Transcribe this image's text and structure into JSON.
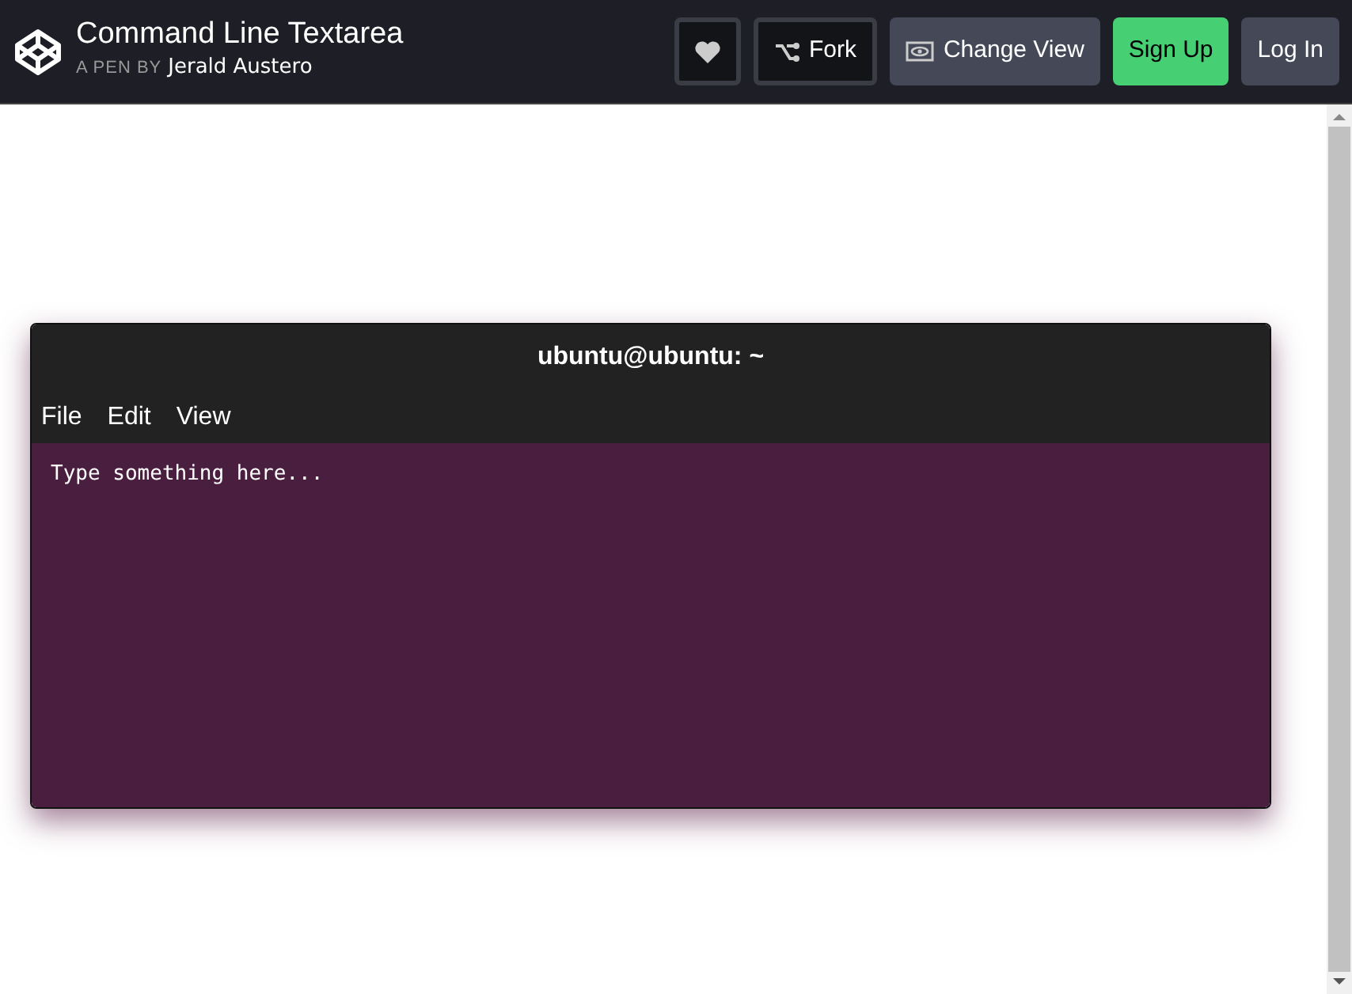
{
  "header": {
    "title": "Command Line Textarea",
    "byline_prefix": "A PEN BY",
    "author": "Jerald Austero",
    "buttons": [
      {
        "kind": "heart"
      },
      {
        "kind": "fork",
        "label": "Fork"
      },
      {
        "kind": "view",
        "label": "Change View"
      },
      {
        "kind": "signup",
        "label": "Sign Up"
      },
      {
        "kind": "login",
        "label": "Log In"
      }
    ]
  },
  "terminal": {
    "title": "ubuntu@ubuntu: ~",
    "menu": [
      "File",
      "Edit",
      "View"
    ],
    "placeholder": "Type something here..."
  }
}
